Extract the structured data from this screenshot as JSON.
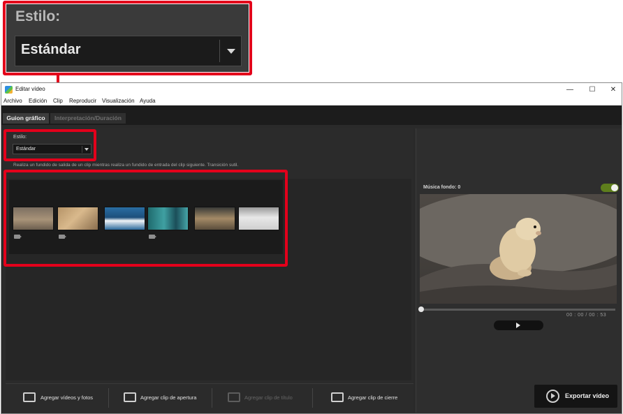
{
  "callout": {
    "label": "Estilo:",
    "value": "Estándar"
  },
  "window": {
    "title": "Editar vídeo",
    "controls": [
      "—",
      "☐",
      "✕"
    ]
  },
  "menu": [
    "Archivo",
    "Edición",
    "Clip",
    "Reproducir",
    "Visualización",
    "Ayuda"
  ],
  "tabs": [
    "Guion gráfico",
    "Interpretación/Duración"
  ],
  "style": {
    "label": "Estilo:",
    "value": "Estándar",
    "description": "Realiza un fundido de salida de un clip mientras realiza un fundido de entrada del clip siguiente. Transición sutil."
  },
  "bottom_buttons": [
    "Agregar vídeos y fotos",
    "Agregar clip de apertura",
    "Agregar clip de título",
    "Agregar clip de cierre"
  ],
  "preview": {
    "music_label": "Música fondo: 0",
    "time_current": "00 : 00",
    "time_sep": "/",
    "time_total": "00 : 53",
    "export_label": "Exportar vídeo"
  },
  "colors": {
    "highlight": "#e3001b",
    "toggle_on": "#5e7e1c"
  }
}
